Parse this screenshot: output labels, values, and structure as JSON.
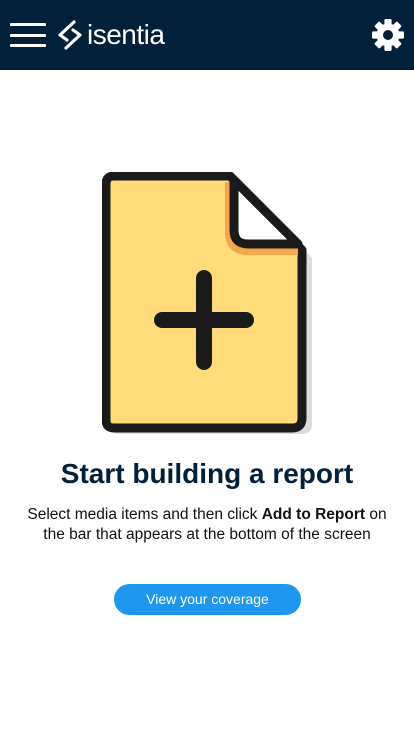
{
  "header": {
    "logo_text": "isentia",
    "menu_icon": "hamburger-menu-icon",
    "settings_icon": "gear-icon",
    "background_color": "#03203b"
  },
  "empty_state": {
    "illustration_icon": "document-add-icon",
    "title": "Start building a report",
    "description_before": "Select media items and then click ",
    "description_bold": "Add to Report",
    "description_after": " on the bar that appears at the bottom of the screen",
    "cta_label": "View your coverage",
    "cta_color": "#1f97ee",
    "illustration_fill": "#ffdb79",
    "illustration_accent": "#f5a64a"
  }
}
